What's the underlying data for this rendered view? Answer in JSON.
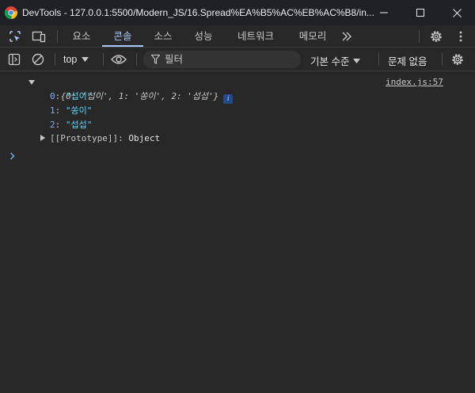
{
  "window": {
    "title": "DevTools - 127.0.0.1:5500/Modern_JS/16.Spread%EA%B5%AC%EB%AC%B8/in..."
  },
  "tabs": [
    {
      "label": "요소"
    },
    {
      "label": "콘솔"
    },
    {
      "label": "소스"
    },
    {
      "label": "성능"
    },
    {
      "label": "네트워크"
    },
    {
      "label": "메모리"
    }
  ],
  "toolbar": {
    "context": "top",
    "filter_placeholder": "필터",
    "levels": "기본 수준",
    "issues": "문제 없음"
  },
  "console": {
    "object_preview": "{0: '섭이', 1: '쏭이', 2: '섭섭'}",
    "source_link": "index.js:57",
    "entries": [
      {
        "key": "0",
        "value": "\"섭이\""
      },
      {
        "key": "1",
        "value": "\"쏭이\""
      },
      {
        "key": "2",
        "value": "\"섭섭\""
      }
    ],
    "prototype_label": "[[Prototype]]",
    "prototype_value": "Object"
  },
  "colors": {
    "background": "#282828",
    "accent": "#a8c7fa",
    "string": "#5cd5fb"
  }
}
